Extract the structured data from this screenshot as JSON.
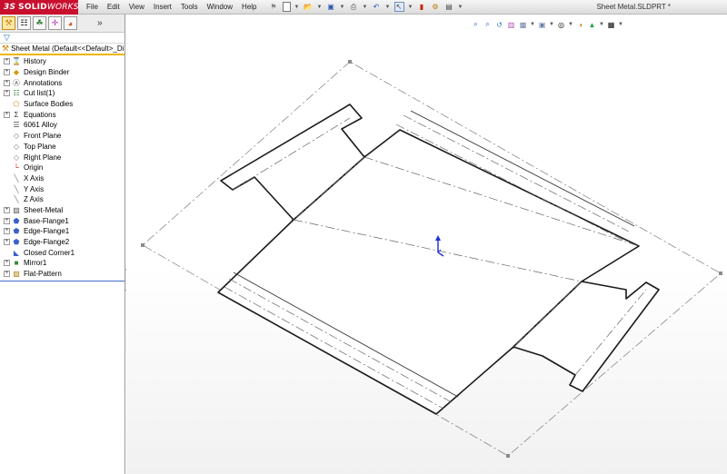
{
  "app": {
    "brand_prefix": "3S",
    "brand_name": "SOLID",
    "brand_suffix": "WORKS",
    "document_title": "Sheet Metal.SLDPRT *"
  },
  "menu": [
    "File",
    "Edit",
    "View",
    "Insert",
    "Tools",
    "Window",
    "Help"
  ],
  "icons": {
    "pin": "pin-icon",
    "new": "new-document-icon",
    "open": "open-folder-icon",
    "save": "save-icon",
    "print": "print-icon",
    "undo": "undo-icon",
    "select": "select-arrow-icon",
    "rebuild": "traffic-light-icon",
    "options": "options-icon"
  },
  "panel": {
    "tabs": [
      "feature-manager",
      "property-manager",
      "configuration-manager",
      "dimxpert-manager",
      "display-manager"
    ],
    "more": "»",
    "root_label": "Sheet Metal  (Default<<Default>_Di",
    "items": [
      {
        "label": "History",
        "expandable": true,
        "icon": "history-icon"
      },
      {
        "label": "Design Binder",
        "expandable": true,
        "icon": "design-binder-icon"
      },
      {
        "label": "Annotations",
        "expandable": true,
        "icon": "annotations-icon"
      },
      {
        "label": "Cut list(1)",
        "expandable": true,
        "icon": "cut-list-icon"
      },
      {
        "label": "Surface Bodies",
        "expandable": false,
        "icon": "surface-bodies-icon"
      },
      {
        "label": "Equations",
        "expandable": true,
        "icon": "equations-icon"
      },
      {
        "label": "6061 Alloy",
        "expandable": false,
        "icon": "material-icon"
      },
      {
        "label": "Front Plane",
        "expandable": false,
        "icon": "plane-icon"
      },
      {
        "label": "Top Plane",
        "expandable": false,
        "icon": "plane-icon"
      },
      {
        "label": "Right Plane",
        "expandable": false,
        "icon": "plane-icon"
      },
      {
        "label": "Origin",
        "expandable": false,
        "icon": "origin-icon"
      },
      {
        "label": "X Axis",
        "expandable": false,
        "icon": "axis-icon"
      },
      {
        "label": "Y Axis",
        "expandable": false,
        "icon": "axis-icon"
      },
      {
        "label": "Z Axis",
        "expandable": false,
        "icon": "axis-icon"
      },
      {
        "label": "Sheet-Metal",
        "expandable": true,
        "icon": "sheet-metal-icon"
      },
      {
        "label": "Base-Flange1",
        "expandable": true,
        "icon": "base-flange-icon"
      },
      {
        "label": "Edge-Flange1",
        "expandable": true,
        "icon": "edge-flange-icon"
      },
      {
        "label": "Edge-Flange2",
        "expandable": true,
        "icon": "edge-flange-icon"
      },
      {
        "label": "Closed Corner1",
        "expandable": false,
        "icon": "closed-corner-icon"
      },
      {
        "label": "Mirror1",
        "expandable": true,
        "icon": "mirror-icon"
      },
      {
        "label": "Flat-Pattern",
        "expandable": true,
        "icon": "flat-pattern-icon"
      }
    ]
  },
  "view_toolbar": [
    "zoom-to-fit-icon",
    "zoom-to-area-icon",
    "previous-view-icon",
    "section-view-icon",
    "view-orientation-icon",
    "display-style-icon",
    "hide-show-icon",
    "edit-appearance-icon",
    "apply-scene-icon",
    "view-settings-icon"
  ],
  "colors": {
    "brand": "#c8102e",
    "tree_end_line": "#3f6ecf",
    "root_underline": "#f0b400",
    "triad": "#1f2fd6"
  }
}
